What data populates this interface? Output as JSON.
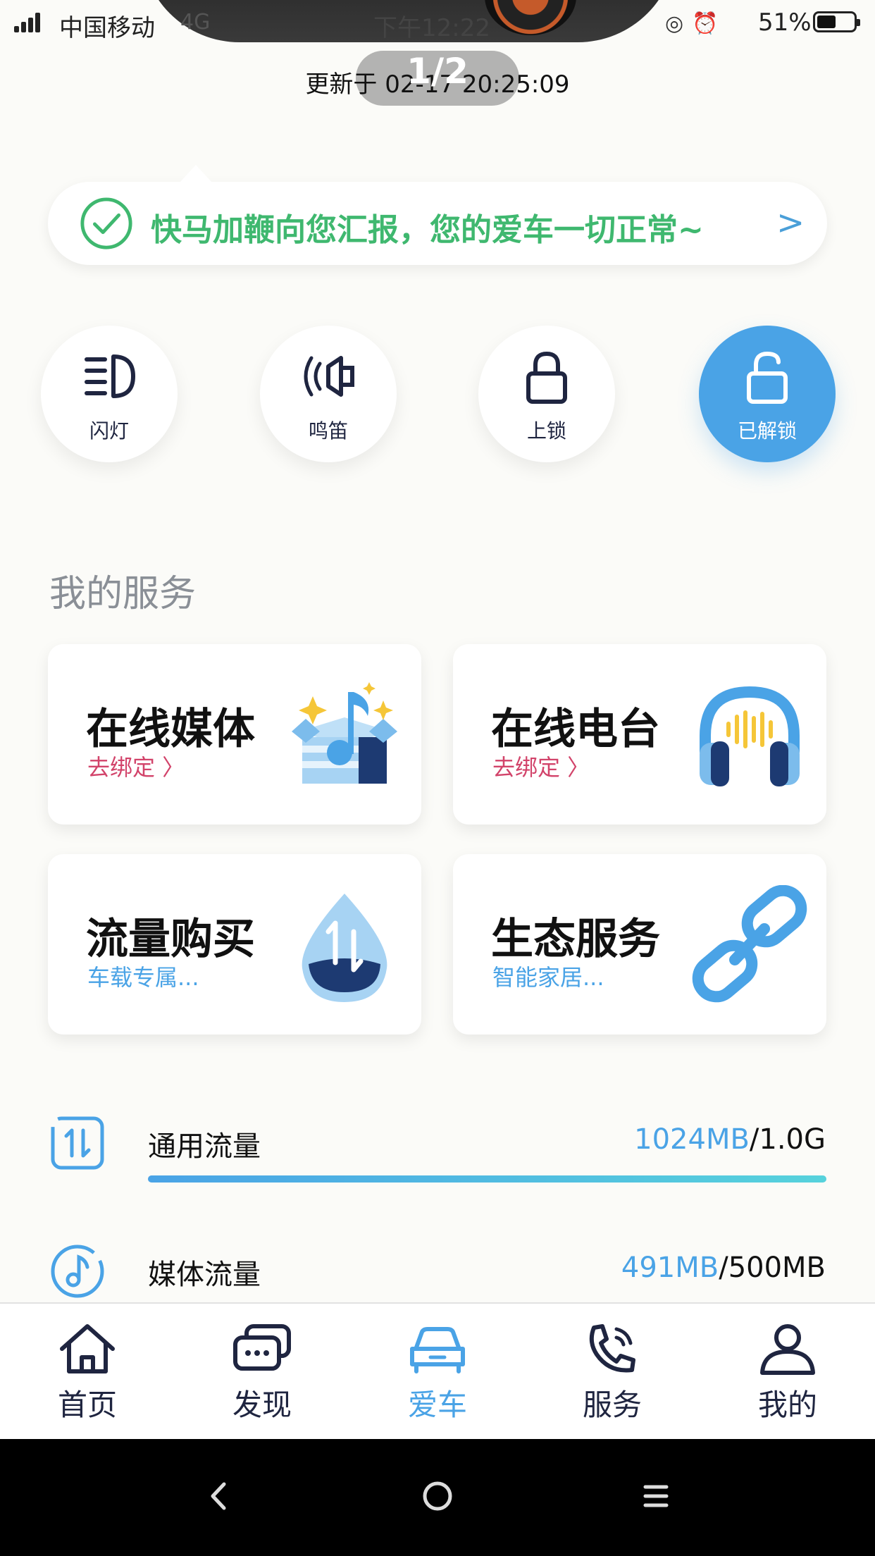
{
  "status_bar": {
    "carrier": "中国移动",
    "network": "4G",
    "time": "下午12:22",
    "battery_percent": "51%",
    "battery_level": 0.51
  },
  "header": {
    "page_indicator": "1/2",
    "update_time": "更新于 02-17 20:25:09"
  },
  "notice": {
    "text": "快马加鞭向您汇报，您的爱车一切正常~"
  },
  "controls": [
    {
      "label": "闪灯",
      "icon": "headlight-icon",
      "active": false
    },
    {
      "label": "鸣笛",
      "icon": "horn-icon",
      "active": false
    },
    {
      "label": "上锁",
      "icon": "lock-icon",
      "active": false
    },
    {
      "label": "已解锁",
      "icon": "unlock-icon",
      "active": true
    }
  ],
  "services": {
    "title": "我的服务",
    "cards": [
      {
        "title": "在线媒体",
        "subtitle": "去绑定 〉",
        "icon": "music-box-icon",
        "subtitle_color": "#d2436a"
      },
      {
        "title": "在线电台",
        "subtitle": "去绑定 〉",
        "icon": "headphones-icon",
        "subtitle_color": "#d2436a"
      },
      {
        "title": "流量购买",
        "subtitle": "车载专属...",
        "icon": "data-drop-icon",
        "subtitle_color": "#4aa3e6"
      },
      {
        "title": "生态服务",
        "subtitle": "智能家居...",
        "icon": "link-icon",
        "subtitle_color": "#4aa3e6"
      }
    ]
  },
  "data_usage": [
    {
      "name": "通用流量",
      "used": "1024MB",
      "total": "/1.0G",
      "fraction": 1.0,
      "icon": "data-transfer-icon"
    },
    {
      "name": "媒体流量",
      "used": "491MB",
      "total": "/500MB",
      "fraction": 0.982,
      "icon": "music-note-icon"
    }
  ],
  "tabs": [
    {
      "label": "首页",
      "icon": "home-icon",
      "active": false
    },
    {
      "label": "发现",
      "icon": "discover-chat-icon",
      "active": false
    },
    {
      "label": "爱车",
      "icon": "car-icon",
      "active": true
    },
    {
      "label": "服务",
      "icon": "phone-service-icon",
      "active": false
    },
    {
      "label": "我的",
      "icon": "profile-icon",
      "active": false
    }
  ],
  "colors": {
    "accent": "#4aa3e6",
    "success": "#3fb86f",
    "link_red": "#d2436a",
    "nav_text": "#1f2540"
  }
}
